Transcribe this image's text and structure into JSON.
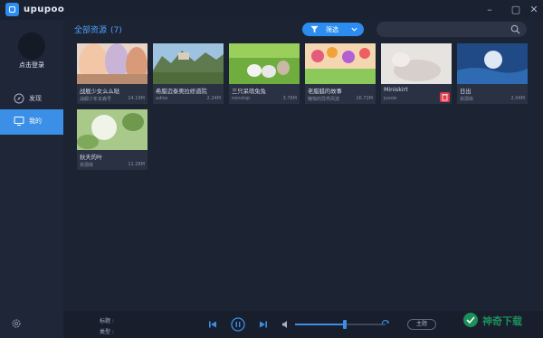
{
  "app": {
    "name": "upupoo"
  },
  "sidebar": {
    "login_label": "点击登录",
    "items": [
      {
        "label": "发现",
        "icon": "compass-icon",
        "active": false
      },
      {
        "label": "我的",
        "icon": "monitor-icon",
        "active": true
      }
    ]
  },
  "header": {
    "title": "全部资源",
    "count": "(7)",
    "filter_label": "筛选",
    "search_placeholder": ""
  },
  "resources": [
    {
      "title": "战舰少女么么哒",
      "author": "战舰少年本森号",
      "size": "14.19M"
    },
    {
      "title": "希腊迈泰奥拉修道院",
      "author": "adios",
      "size": "2.24M"
    },
    {
      "title": "三只呆萌兔兔",
      "author": "nonstop",
      "size": "3.76M"
    },
    {
      "title": "老腊腊的故事",
      "author": "懒惰的异界风流",
      "size": "16.72M"
    },
    {
      "title": "Miniskirt",
      "author": "jussie",
      "size": ""
    },
    {
      "title": "日出",
      "author": "资源库",
      "size": "2.04M"
    },
    {
      "title": "秋天的叶",
      "author": "资源库",
      "size": "11.26M"
    }
  ],
  "player": {
    "title_label": "标题 :",
    "type_label": "类型 :",
    "volume": 0.55,
    "pill_label": "主题"
  },
  "watermark": {
    "text": "神奇下载"
  },
  "colors": {
    "accent": "#3b8fe6",
    "delete": "#e23b4b",
    "background": "#1b2232"
  }
}
